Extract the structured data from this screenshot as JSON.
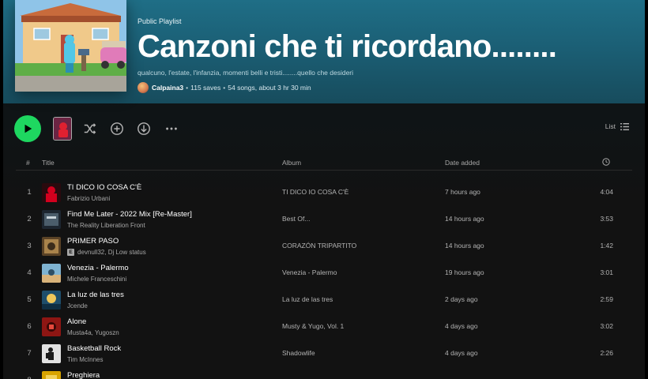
{
  "playlist": {
    "eyebrow": "Public Playlist",
    "title": "Canzoni che ti ricordano........",
    "description": "qualcuno, l'estate, l'infanzia, momenti belli e tristi........quello che desideri",
    "owner": "Calpaina3",
    "saves": "115 saves",
    "summary": "54 songs, about 3 hr 30 min"
  },
  "actions": {
    "view_label": "List"
  },
  "table": {
    "col_num": "#",
    "col_title": "Title",
    "col_album": "Album",
    "col_date": "Date added"
  },
  "tracks": [
    {
      "num": "1",
      "title": "TI DICO IO COSA C'È",
      "artist": "Fabrizio Urbani",
      "explicit": false,
      "album": "TI DICO IO COSA C'È",
      "date": "7 hours ago",
      "duration": "4:04",
      "art_color": "#b3001b"
    },
    {
      "num": "2",
      "title": "Find Me Later - 2022 Mix [Re-Master]",
      "artist": "The Reality Liberation Front",
      "explicit": false,
      "album": "Best Of...",
      "date": "14 hours ago",
      "duration": "3:53",
      "art_color": "#3a4a56"
    },
    {
      "num": "3",
      "title": "PRIMER PASO",
      "artist": "devnull32, Dj Low status",
      "explicit": true,
      "album": "CORAZÓN TRIPARTITO",
      "date": "14 hours ago",
      "duration": "1:42",
      "art_color": "#8a6a3c"
    },
    {
      "num": "4",
      "title": "Venezia - Palermo",
      "artist": "Michele Franceschini",
      "explicit": false,
      "album": "Venezia - Palermo",
      "date": "19 hours ago",
      "duration": "3:01",
      "art_color": "#4f8fb5"
    },
    {
      "num": "5",
      "title": "La luz de las tres",
      "artist": "Jcende",
      "explicit": false,
      "album": "La luz de las tres",
      "date": "2 days ago",
      "duration": "2:59",
      "art_color": "#2a6a8a"
    },
    {
      "num": "6",
      "title": "Alone",
      "artist": "Musta4a, Yugoszn",
      "explicit": false,
      "album": "Musty & Yugo, Vol. 1",
      "date": "4 days ago",
      "duration": "3:02",
      "art_color": "#b0201c"
    },
    {
      "num": "7",
      "title": "Basketball Rock",
      "artist": "Tim McInnes",
      "explicit": false,
      "album": "Shadowlife",
      "date": "4 days ago",
      "duration": "2:26",
      "art_color": "#d8d8d8"
    },
    {
      "num": "8",
      "title": "Preghiera",
      "artist": "",
      "explicit": false,
      "album": "",
      "date": "",
      "duration": "",
      "art_color": "#d9a400"
    }
  ],
  "colors": {
    "accent": "#1ed760",
    "header": "#1f6e86",
    "background": "#121212"
  }
}
